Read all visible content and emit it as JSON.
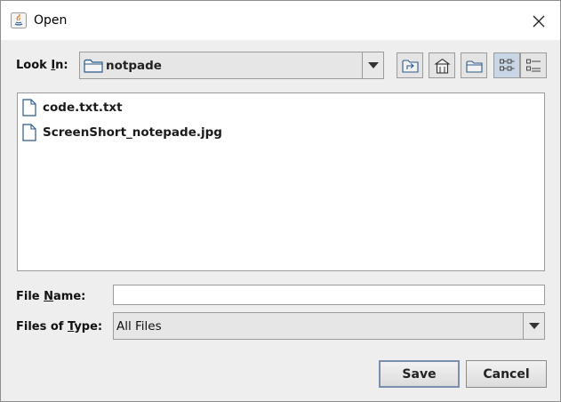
{
  "window": {
    "title": "Open"
  },
  "look_in": {
    "label_pre": "Look ",
    "label_key": "I",
    "label_post": "n:",
    "value": "notpade"
  },
  "toolbar": {
    "buttons": [
      {
        "name": "up-one-level",
        "icon": "folder-up-icon"
      },
      {
        "name": "home",
        "icon": "home-icon"
      },
      {
        "name": "new-folder",
        "icon": "new-folder-icon"
      },
      {
        "name": "list-view",
        "icon": "list-view-icon",
        "pressed": true
      },
      {
        "name": "details-view",
        "icon": "details-view-icon"
      }
    ]
  },
  "files": [
    {
      "name": "code.txt.txt"
    },
    {
      "name": "ScreenShort_notepade.jpg"
    }
  ],
  "file_name": {
    "label_pre": "File ",
    "label_key": "N",
    "label_post": "ame:",
    "value": ""
  },
  "file_type": {
    "label_pre": "Files of ",
    "label_key": "T",
    "label_post": "ype:",
    "value": "All Files"
  },
  "actions": {
    "save": "Save",
    "cancel": "Cancel"
  },
  "colors": {
    "background": "#eeeeee",
    "titlebar": "#ffffff",
    "pressed": "#c9d6e6",
    "icon_blue": "#2b5a8a"
  }
}
